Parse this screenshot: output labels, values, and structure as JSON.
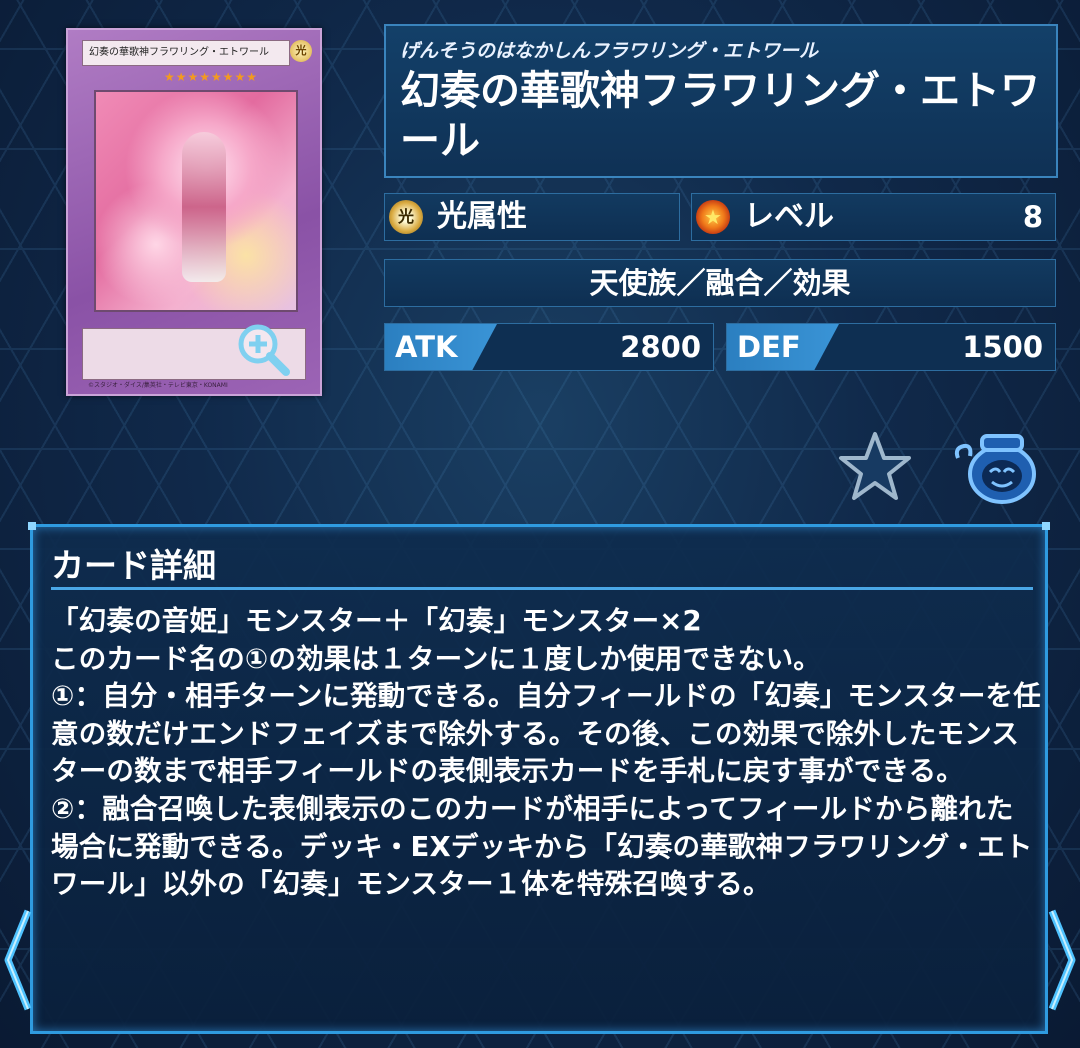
{
  "card": {
    "name_small": "幻奏の華歌神フラワリング・エトワール",
    "attribute_small": "光",
    "stars": "★★★★★★★★",
    "copyright": "©スタジオ・ダイス/集英社・テレビ東京・KONAMI"
  },
  "header": {
    "ruby": "げんそうのはなかしんフラワリング・エトワール",
    "name": "幻奏の華歌神フラワリング・エトワール"
  },
  "attribute": {
    "icon_text": "光",
    "label": "光属性"
  },
  "level": {
    "label": "レベル",
    "value": "8"
  },
  "type": "天使族／融合／効果",
  "stats": {
    "atk_label": "ATK",
    "atk": "2800",
    "def_label": "DEF",
    "def": "1500"
  },
  "detail": {
    "title": "カード詳細",
    "text": "「幻奏の音姫」モンスター＋「幻奏」モンスター×2\nこのカード名の①の効果は１ターンに１度しか使用できない。\n①：自分・相手ターンに発動できる。自分フィールドの「幻奏」モンスターを任意の数だけエンドフェイズまで除外する。その後、この効果で除外したモンスターの数まで相手フィールドの表側表示カードを手札に戻す事ができる。\n②：融合召喚した表側表示のこのカードが相手によってフィールドから離れた場合に発動できる。デッキ・EXデッキから「幻奏の華歌神フラワリング・エトワール」以外の「幻奏」モンスター１体を特殊召喚する。"
  },
  "icons": {
    "zoom": "zoom-in-icon",
    "favorite": "star-icon",
    "pot": "pot-of-greed-icon",
    "prev": "chevron-left-icon",
    "next": "chevron-right-icon"
  },
  "colors": {
    "accent": "#2f9be0",
    "panel": "#123a60",
    "stat_label": "#3a94d6"
  }
}
